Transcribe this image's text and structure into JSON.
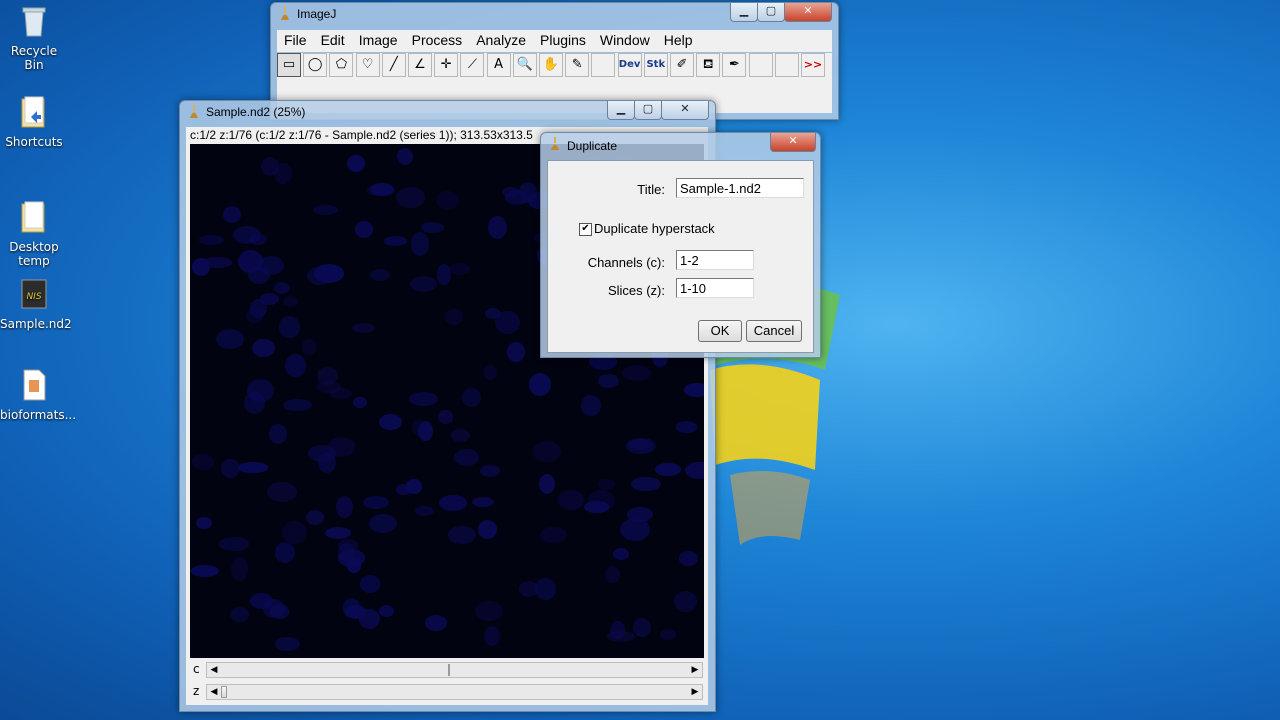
{
  "desktop": {
    "icons": [
      {
        "label": "Recycle Bin",
        "icon": "recycle-bin-icon"
      },
      {
        "label": "Shortcuts",
        "icon": "folder-icon"
      },
      {
        "label": "Desktop\ntemp",
        "icon": "folder-icon"
      },
      {
        "label": "Sample.nd2",
        "icon": "nis-file-icon"
      },
      {
        "label": "bioformats...",
        "icon": "java-file-icon"
      }
    ]
  },
  "imagej": {
    "title": "ImageJ",
    "menu": [
      "File",
      "Edit",
      "Image",
      "Process",
      "Analyze",
      "Plugins",
      "Window",
      "Help"
    ],
    "tools": [
      {
        "name": "rectangle-tool-icon",
        "glyph": "▭"
      },
      {
        "name": "oval-tool-icon",
        "glyph": "◯"
      },
      {
        "name": "polygon-tool-icon",
        "glyph": "⬠"
      },
      {
        "name": "freehand-tool-icon",
        "glyph": "♡"
      },
      {
        "name": "line-tool-icon",
        "glyph": "╱"
      },
      {
        "name": "angle-tool-icon",
        "glyph": "∠"
      },
      {
        "name": "point-tool-icon",
        "glyph": "✛"
      },
      {
        "name": "wand-tool-icon",
        "glyph": "⟋"
      },
      {
        "name": "text-tool-icon",
        "glyph": "A"
      },
      {
        "name": "magnifier-tool-icon",
        "glyph": "🔍"
      },
      {
        "name": "hand-tool-icon",
        "glyph": "✋"
      },
      {
        "name": "dropper-tool-icon",
        "glyph": "✎"
      },
      {
        "name": "empty-tool-slot",
        "glyph": ""
      },
      {
        "name": "dev-tool-icon",
        "glyph": "Dev"
      },
      {
        "name": "stk-tool-icon",
        "glyph": "Stk"
      },
      {
        "name": "brush-tool-icon",
        "glyph": "✐"
      },
      {
        "name": "flood-fill-tool-icon",
        "glyph": "⛾"
      },
      {
        "name": "pencil-tool-icon",
        "glyph": "✒"
      },
      {
        "name": "empty-tool-slot",
        "glyph": ""
      },
      {
        "name": "empty-tool-slot",
        "glyph": ""
      },
      {
        "name": "more-tools-icon",
        "glyph": ">>"
      }
    ]
  },
  "imagewin": {
    "title": "Sample.nd2 (25%)",
    "info": "c:1/2 z:1/76 (c:1/2  z:1/76 - Sample.nd2 (series 1)); 313.53x313.5",
    "slider_c_label": "c",
    "slider_z_label": "z"
  },
  "dialog": {
    "title": "Duplicate",
    "title_label": "Title:",
    "title_value": "Sample-1.nd2",
    "hyperstack_label": "Duplicate hyperstack",
    "hyperstack_checked": true,
    "channels_label": "Channels (c):",
    "channels_value": "1-2",
    "slices_label": "Slices (z):",
    "slices_value": "1-10",
    "ok_label": "OK",
    "cancel_label": "Cancel"
  },
  "colors": {
    "canvas_bg": "#020310",
    "nucleus": "#0a0a55",
    "desktop_accent": "#1679d0"
  }
}
